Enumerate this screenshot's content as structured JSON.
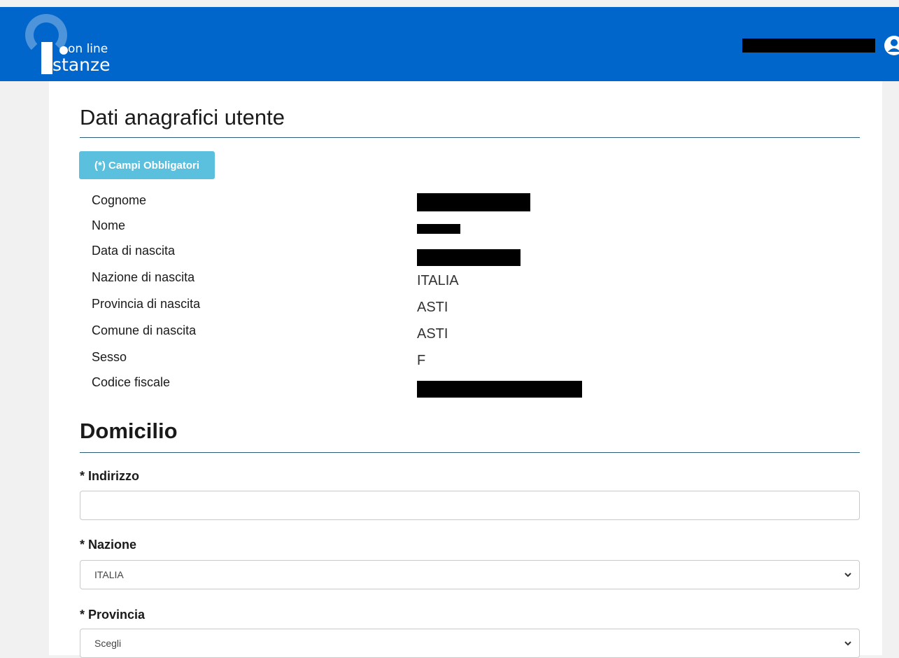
{
  "header": {
    "logo_line1": "on line",
    "logo_line2": "stanze",
    "user_icon": "user-icon"
  },
  "anagrafica": {
    "title": "Dati anagrafici utente",
    "required_badge": "(*) Campi Obbligatori",
    "rows": [
      {
        "label": "Cognome",
        "value": ""
      },
      {
        "label": "Nome",
        "value": ""
      },
      {
        "label": "Data di nascita",
        "value": ""
      },
      {
        "label": "Nazione di nascita",
        "value": "ITALIA"
      },
      {
        "label": "Provincia di nascita",
        "value": "ASTI"
      },
      {
        "label": "Comune di nascita",
        "value": "ASTI"
      },
      {
        "label": "Sesso",
        "value": "F"
      },
      {
        "label": "Codice fiscale",
        "value": ""
      }
    ]
  },
  "domicilio": {
    "title": "Domicilio",
    "indirizzo": {
      "label": "* Indirizzo",
      "value": ""
    },
    "nazione": {
      "label": "* Nazione",
      "selected": "ITALIA"
    },
    "provincia": {
      "label": "* Provincia",
      "selected": "Scegli"
    }
  },
  "colors": {
    "header_bg": "#0066cc",
    "badge_bg": "#5bc0de",
    "divider": "#2c5a7a"
  }
}
